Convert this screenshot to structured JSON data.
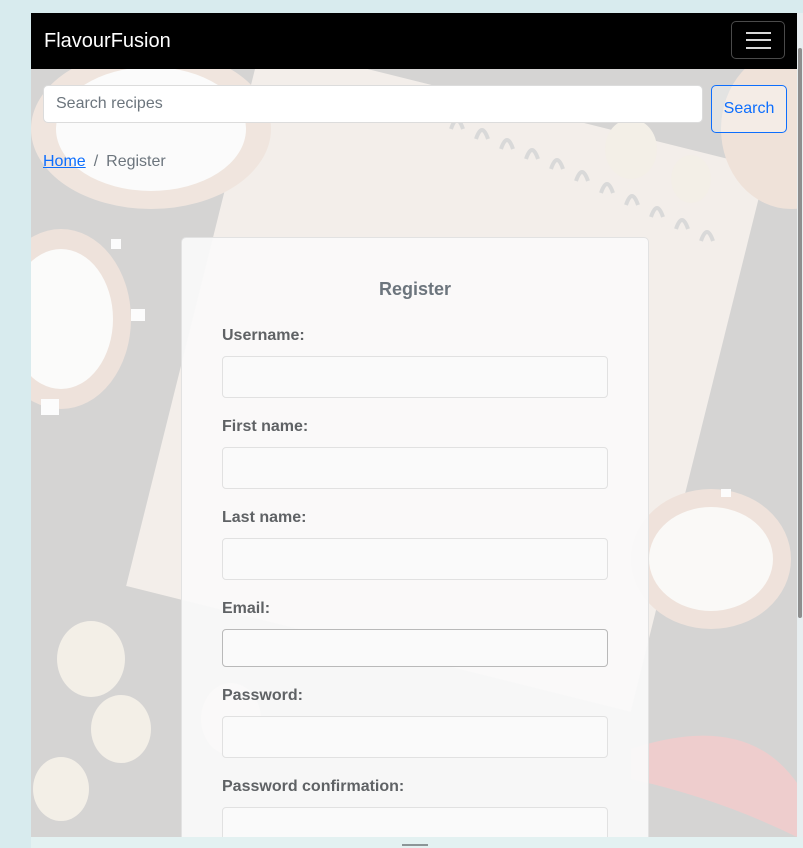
{
  "navbar": {
    "brand": "FlavourFusion"
  },
  "search": {
    "placeholder": "Search recipes",
    "button_label": "Search"
  },
  "breadcrumb": {
    "home_label": "Home",
    "separator": "/",
    "current_label": "Register"
  },
  "form": {
    "title": "Register",
    "fields": [
      {
        "label": "Username:",
        "value": ""
      },
      {
        "label": "First name:",
        "value": ""
      },
      {
        "label": "Last name:",
        "value": ""
      },
      {
        "label": "Email:",
        "value": ""
      },
      {
        "label": "Password:",
        "value": ""
      },
      {
        "label": "Password confirmation:",
        "value": ""
      }
    ]
  },
  "colors": {
    "navbar_bg": "#000000",
    "accent": "#0d6efd",
    "muted_text": "#6c757d"
  }
}
